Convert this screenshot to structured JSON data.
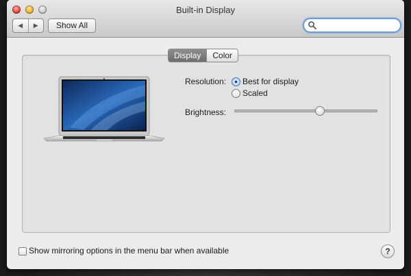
{
  "window": {
    "title": "Built-in Display"
  },
  "toolbar": {
    "back_icon": "◀",
    "forward_icon": "▶",
    "show_all_label": "Show All",
    "search_value": "",
    "search_placeholder": ""
  },
  "tabs": [
    {
      "label": "Display",
      "active": true
    },
    {
      "label": "Color",
      "active": false
    }
  ],
  "display": {
    "resolution_label": "Resolution:",
    "resolution_options": [
      {
        "label": "Best for display",
        "selected": true
      },
      {
        "label": "Scaled",
        "selected": false
      }
    ],
    "brightness_label": "Brightness:",
    "brightness_level": 0.6
  },
  "footer": {
    "mirroring_label": "Show mirroring options in the menu bar when available",
    "mirroring_checked": false,
    "help_label": "?"
  },
  "icons": {
    "laptop": "laptop-image",
    "search": "search-icon",
    "help": "help-icon"
  },
  "colors": {
    "accent": "#3d6fb8",
    "active_tab": "#7e7e7e",
    "search_focus": "#6a9cd8"
  }
}
